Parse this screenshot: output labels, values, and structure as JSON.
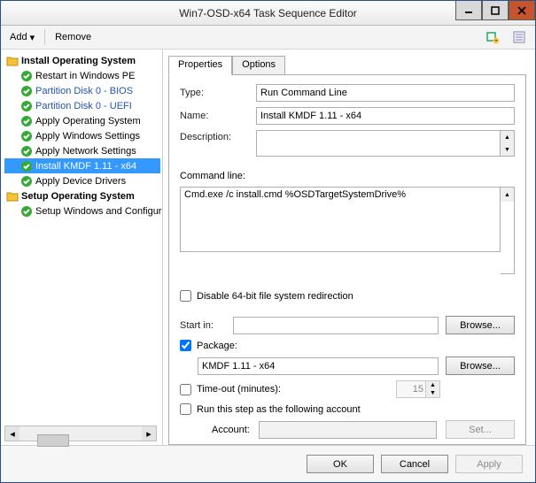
{
  "window": {
    "title": "Win7-OSD-x64 Task Sequence Editor"
  },
  "toolbar": {
    "add": "Add",
    "remove": "Remove"
  },
  "tree": {
    "group1": "Install Operating System",
    "g1_items": [
      "Restart in Windows PE",
      "Partition Disk 0 - BIOS",
      "Partition Disk 0 - UEFI",
      "Apply Operating System",
      "Apply Windows Settings",
      "Apply Network Settings",
      "Install KMDF 1.11 - x64",
      "Apply Device Drivers"
    ],
    "group2": "Setup Operating System",
    "g2_items": [
      "Setup Windows and Configuration"
    ]
  },
  "tabs": {
    "properties": "Properties",
    "options": "Options"
  },
  "form": {
    "type_label": "Type:",
    "type_value": "Run Command Line",
    "name_label": "Name:",
    "name_value": "Install KMDF 1.11 - x64",
    "desc_label": "Description:",
    "desc_value": "",
    "cmd_label": "Command line:",
    "cmd_value": "Cmd.exe /c install.cmd %OSDTargetSystemDrive%",
    "disable64": "Disable 64-bit file system redirection",
    "startin_label": "Start in:",
    "startin_value": "",
    "browse": "Browse...",
    "package_label": "Package:",
    "package_value": "KMDF 1.11 - x64",
    "timeout_label": "Time-out (minutes):",
    "timeout_value": "15",
    "runas_label": "Run this step as the following account",
    "account_label": "Account:",
    "account_value": "",
    "set_btn": "Set..."
  },
  "footer": {
    "ok": "OK",
    "cancel": "Cancel",
    "apply": "Apply"
  }
}
